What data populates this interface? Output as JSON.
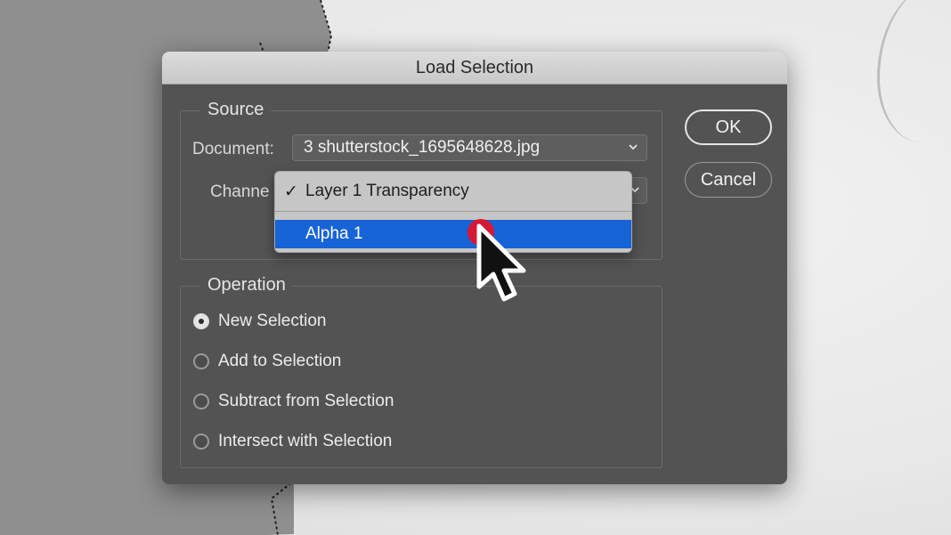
{
  "dialog": {
    "title": "Load Selection",
    "source": {
      "label": "Source",
      "document_label": "Document:",
      "document_value": "3 shutterstock_1695648628.jpg",
      "channel_label": "Channe",
      "channel_menu": {
        "items": [
          {
            "label": "Layer 1 Transparency",
            "checked": true
          },
          {
            "label": "Alpha 1",
            "highlighted": true
          }
        ],
        "highlight_color": "#1764d6"
      }
    },
    "operation": {
      "label": "Operation",
      "options": [
        {
          "label": "New Selection",
          "selected": true
        },
        {
          "label": "Add to Selection",
          "selected": false
        },
        {
          "label": "Subtract from Selection",
          "selected": false
        },
        {
          "label": "Intersect with Selection",
          "selected": false
        }
      ]
    },
    "buttons": {
      "ok": "OK",
      "cancel": "Cancel"
    }
  },
  "icons": {
    "check": "checkmark-icon",
    "chevron": "chevron-down-icon",
    "cursor": "arrow-cursor-icon"
  },
  "colors": {
    "dialog_bg": "#535353",
    "titlebar": "#d0d0d0",
    "click_indicator": "#e0142a"
  }
}
